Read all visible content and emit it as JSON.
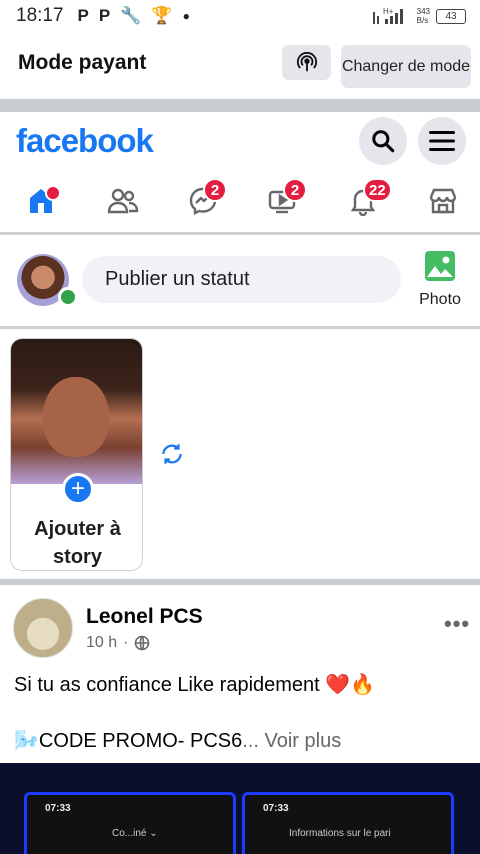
{
  "status_bar": {
    "time": "18:17",
    "net_speed": "343\nB/s",
    "battery": "43"
  },
  "mode_bar": {
    "title": "Mode payant",
    "change_label": "Changer de mode"
  },
  "header": {
    "logo": "facebook"
  },
  "nav": {
    "messages_badge": "2",
    "video_badge": "2",
    "notifications_badge": "22"
  },
  "composer": {
    "placeholder": "Publier un statut",
    "photo_label": "Photo"
  },
  "stories": {
    "add_label": "Ajouter à story"
  },
  "post": {
    "author": "Leonel PCS",
    "time": "10 h",
    "text_line1": "Si tu as confiance Like rapidement ❤️🔥",
    "text_line2": "🌬️CODE PROMO- PCS6",
    "see_more": "... Voir plus",
    "media": {
      "left_time": "07:33",
      "left_title": "Co...iné ⌄",
      "right_time": "07:33",
      "right_title": "Informations sur le pari"
    }
  },
  "colors": {
    "brand": "#1877f2",
    "badge": "#e41e3f",
    "online": "#31a24c"
  }
}
